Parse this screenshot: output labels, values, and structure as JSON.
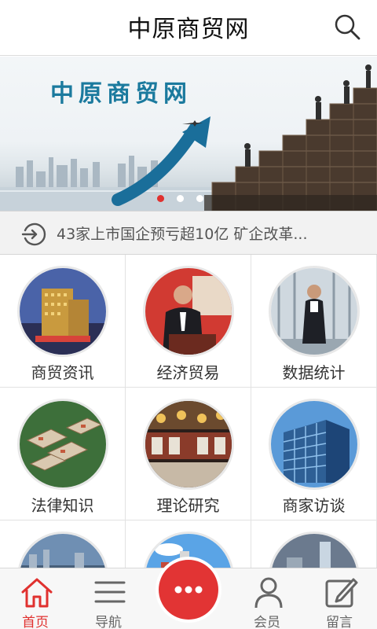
{
  "header": {
    "title": "中原商贸网",
    "search_icon": "search-icon"
  },
  "banner": {
    "title": "中原商贸网",
    "slide_count": 3,
    "active_slide": 0,
    "accent": "#e0312f"
  },
  "ticker": {
    "icon": "refresh-icon",
    "text": "43家上市国企预亏超10亿 矿企改革..."
  },
  "categories": [
    {
      "label": "商贸资讯",
      "icon": "commerce-news-icon"
    },
    {
      "label": "经济贸易",
      "icon": "economy-trade-icon"
    },
    {
      "label": "数据统计",
      "icon": "data-statistics-icon"
    },
    {
      "label": "法律知识",
      "icon": "law-knowledge-icon"
    },
    {
      "label": "理论研究",
      "icon": "theory-research-icon"
    },
    {
      "label": "商家访谈",
      "icon": "merchant-interview-icon"
    }
  ],
  "bottom_nav": [
    {
      "label": "首页",
      "icon": "home-icon",
      "active": true
    },
    {
      "label": "导航",
      "icon": "menu-icon",
      "active": false
    },
    {
      "label": "",
      "icon": "more-icon",
      "active": false
    },
    {
      "label": "会员",
      "icon": "user-icon",
      "active": false
    },
    {
      "label": "留言",
      "icon": "edit-icon",
      "active": false
    }
  ],
  "colors": {
    "brand_red": "#e0312f",
    "banner_blue": "#1b7a9e"
  }
}
